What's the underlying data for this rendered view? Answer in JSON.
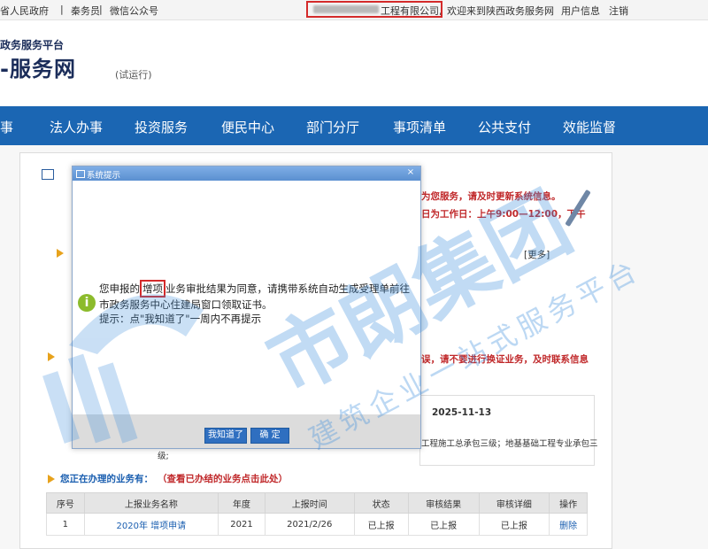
{
  "topbar": {
    "gov_link": "省人民政府",
    "service_staff": "秦务员",
    "wechat": "微信公众号",
    "company_name": "工程有限公司,",
    "welcome": "欢迎来到陕西政务服务网",
    "user_info": "用户信息",
    "logout": "注销"
  },
  "header": {
    "platform_line": "政务服务平台",
    "site_name": "-服务网",
    "trial": "(试运行)"
  },
  "nav": [
    "事",
    "法人办事",
    "投资服务",
    "便民中心",
    "部门分厅",
    "事项清单",
    "公共支付",
    "效能监督"
  ],
  "notice": {
    "line1": "为您服务，请及时更新系统信息。",
    "line2": "日为工作日：上午9:00—12:00，下午",
    "more": "[更多]",
    "warning": "误，请不要进行换证业务，及时联系信息",
    "date": "2025-11-13",
    "qual_text": "工程施工总承包三级；地基基础工程专业承包三",
    "qual_tail": "级;"
  },
  "pending": {
    "label": "您正在办理的业务有：",
    "link": "（查看已办结的业务点击此处）"
  },
  "table": {
    "headers": [
      "序号",
      "上报业务名称",
      "年度",
      "上报时间",
      "状态",
      "审核结果",
      "审核详细",
      "操作"
    ],
    "rows": [
      [
        "1",
        "2020年 增项申请",
        "2021",
        "2021/2/26",
        "已上报",
        "已上报",
        "已上报",
        "删除"
      ]
    ]
  },
  "modal": {
    "title": "系统提示",
    "close": "×",
    "msg_before": "您申报的",
    "msg_highlight": "增项",
    "msg_after": "业务审批结果为同意，请携带系统自动生成受理单前往市政务服务中心住建局窗口领取证书。",
    "tip": "提示：点\"我知道了\"一周内不再提示",
    "btn_know": "我知道了",
    "btn_ok": "确 定"
  },
  "watermark": {
    "brand": "市朗集团",
    "slogan": "建筑企业一站式服务平台"
  },
  "colors": {
    "nav_bg": "#1b66b3",
    "alert_red": "#c0282a",
    "highlight_box": "#d42a2a",
    "info_green": "#8cbb2c"
  },
  "icons": [
    "info-icon",
    "close-icon",
    "arrow-icon",
    "pen-icon",
    "window-icon"
  ]
}
